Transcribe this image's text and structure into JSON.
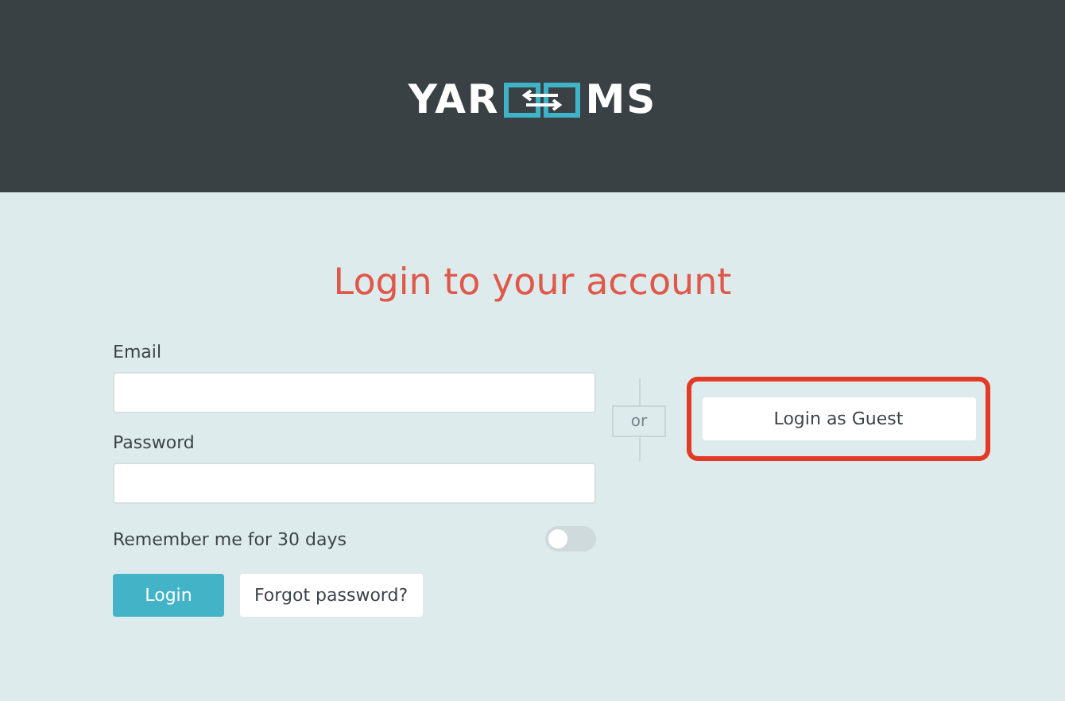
{
  "header": {
    "logo": {
      "left": "YAR",
      "right": "MS"
    }
  },
  "title": "Login to your account",
  "form": {
    "fields": [
      {
        "label": "Email"
      },
      {
        "label": "Password"
      }
    ],
    "remember": {
      "label": "Remember me for 30 days",
      "on": false
    },
    "login_button": "Login",
    "forgot_button": "Forgot password?"
  },
  "divider": "or",
  "guest_button": {
    "label": "Login as Guest",
    "highlighted": true
  }
}
